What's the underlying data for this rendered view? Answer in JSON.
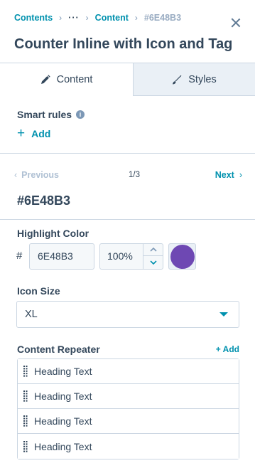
{
  "breadcrumb": {
    "items": [
      "Contents",
      "···",
      "Content"
    ],
    "current": "#6E48B3"
  },
  "header": {
    "title": "Counter Inline with Icon and Tag"
  },
  "tabs": [
    {
      "label": "Content",
      "icon": "pencil-icon",
      "active": true
    },
    {
      "label": "Styles",
      "icon": "brush-icon",
      "active": false
    }
  ],
  "smart_rules": {
    "label": "Smart rules",
    "add_label": "Add"
  },
  "pager": {
    "prev_label": "Previous",
    "next_label": "Next",
    "count": "1/3",
    "item_title": "#6E48B3"
  },
  "highlight_color": {
    "label": "Highlight Color",
    "hash": "#",
    "hex_value": "6E48B3",
    "opacity": "100%",
    "swatch_color": "#6e48b3"
  },
  "icon_size": {
    "label": "Icon Size",
    "value": "XL"
  },
  "content_repeater": {
    "label": "Content Repeater",
    "add_label": "+ Add",
    "items": [
      "Heading Text",
      "Heading Text",
      "Heading Text",
      "Heading Text"
    ]
  },
  "colors": {
    "accent": "#0091ae",
    "text": "#33475b",
    "border": "#cbd6e2",
    "inactive_tab": "#eaf0f6"
  }
}
